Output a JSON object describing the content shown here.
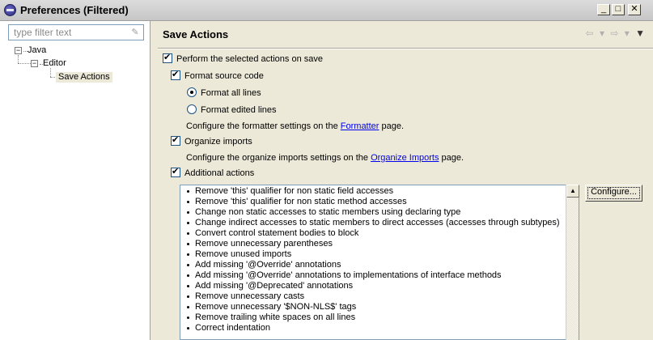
{
  "window": {
    "title": "Preferences (Filtered)",
    "minimize_glyph": "_",
    "maximize_glyph": "□",
    "close_glyph": "✕"
  },
  "filter": {
    "placeholder": "type filter text",
    "clear_icon": "eraser-icon"
  },
  "tree": {
    "expanded_glyph": "−",
    "java": "Java",
    "editor": "Editor",
    "save_actions": "Save Actions"
  },
  "page": {
    "title": "Save Actions",
    "back_glyph": "⇦",
    "forward_glyph": "⇨",
    "dropdown_glyph": "▾",
    "menu_glyph": "▼"
  },
  "options": {
    "perform_on_save": "Perform the selected actions on save",
    "format_source": "Format source code",
    "format_all_lines": "Format all lines",
    "format_edited_lines": "Format edited lines",
    "formatter_text_before": "Configure the formatter settings on the ",
    "formatter_link": "Formatter",
    "formatter_text_after": " page.",
    "organize_imports": "Organize imports",
    "imports_text_before": "Configure the organize imports settings on the ",
    "imports_link": "Organize Imports",
    "imports_text_after": " page.",
    "additional_actions": "Additional actions"
  },
  "additional_actions": [
    "Remove 'this' qualifier for non static field accesses",
    "Remove 'this' qualifier for non static method accesses",
    "Change non static accesses to static members using declaring type",
    "Change indirect accesses to static members to direct accesses (accesses through subtypes)",
    "Convert control statement bodies to block",
    "Remove unnecessary parentheses",
    "Remove unused imports",
    "Add missing '@Override' annotations",
    "Add missing '@Override' annotations to implementations of interface methods",
    "Add missing '@Deprecated' annotations",
    "Remove unnecessary casts",
    "Remove unnecessary '$NON-NLS$' tags",
    "Remove trailing white spaces on all lines",
    "Correct indentation"
  ],
  "configure_button": "Configure...",
  "scroll_up_glyph": "▲"
}
